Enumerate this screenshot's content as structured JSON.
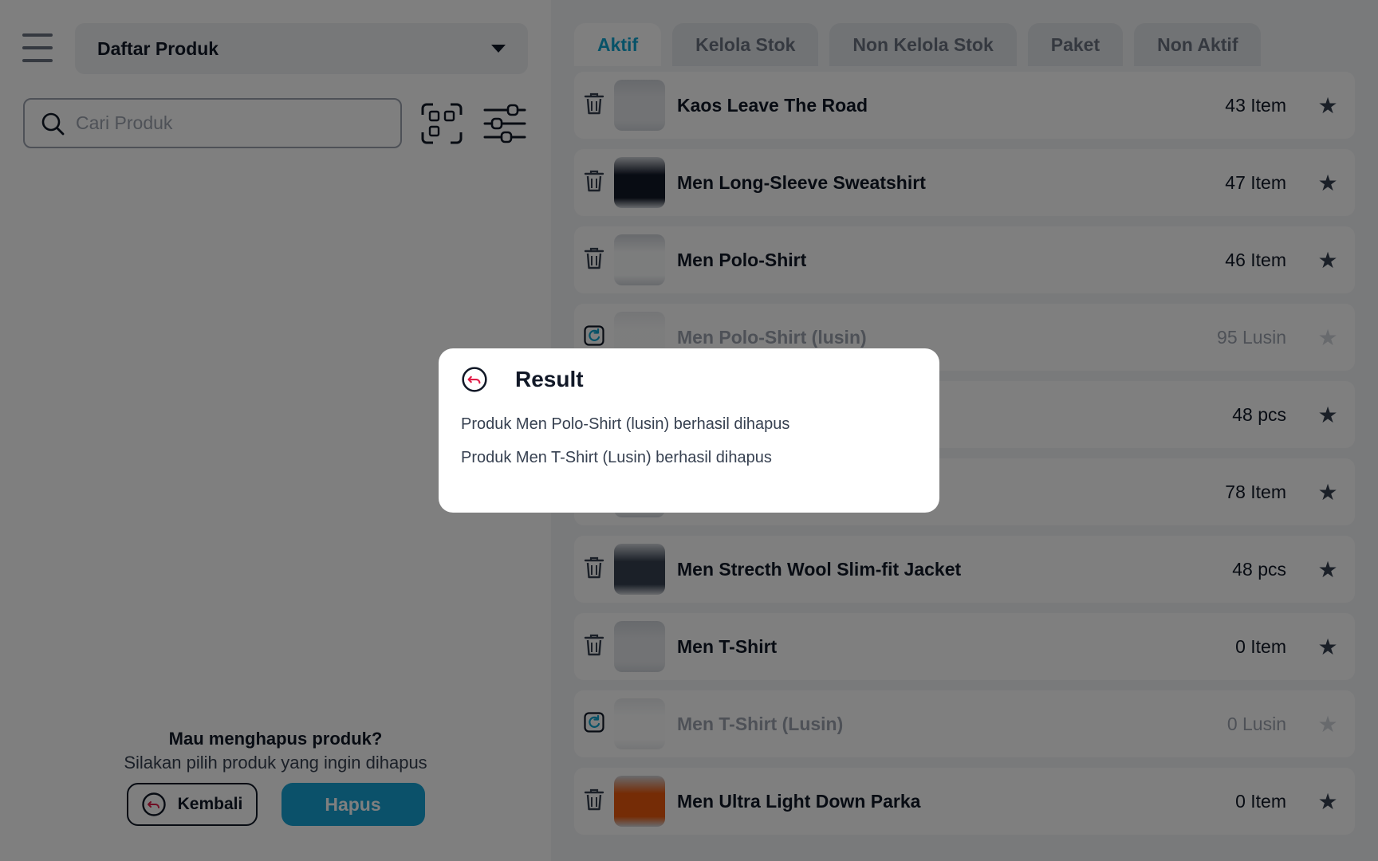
{
  "header": {
    "dropdown_label": "Daftar Produk",
    "search_placeholder": "Cari Produk"
  },
  "tabs": [
    {
      "label": "Aktif",
      "active": true
    },
    {
      "label": "Kelola Stok",
      "active": false
    },
    {
      "label": "Non Kelola Stok",
      "active": false
    },
    {
      "label": "Paket",
      "active": false
    },
    {
      "label": "Non Aktif",
      "active": false
    }
  ],
  "products": [
    {
      "name": "Kaos Leave The Road",
      "qty": "43 Item",
      "state": "active",
      "thumb_color": "#e5e7eb"
    },
    {
      "name": "Men Long-Sleeve Sweatshirt",
      "qty": "47 Item",
      "state": "active",
      "thumb_color": "#111827"
    },
    {
      "name": "Men Polo-Shirt",
      "qty": "46 Item",
      "state": "active",
      "thumb_color": "#f9fafb"
    },
    {
      "name": "Men Polo-Shirt (lusin)",
      "qty": "95 Lusin",
      "state": "inactive",
      "thumb_color": "#f3f4f6"
    },
    {
      "name": "",
      "qty": "48 pcs",
      "state": "active",
      "thumb_color": "#ffffff"
    },
    {
      "name": "",
      "qty": "78 Item",
      "state": "active",
      "thumb_color": "#ffffff"
    },
    {
      "name": "Men Strecth Wool Slim-fit Jacket",
      "qty": "48 pcs",
      "state": "active",
      "thumb_color": "#374151"
    },
    {
      "name": "Men T-Shirt",
      "qty": "0 Item",
      "state": "active",
      "thumb_color": "#e5e7eb"
    },
    {
      "name": "Men T-Shirt (Lusin)",
      "qty": "0 Lusin",
      "state": "inactive",
      "thumb_color": "#f9fafb"
    },
    {
      "name": "Men Ultra Light Down Parka",
      "qty": "0 Item",
      "state": "active",
      "thumb_color": "#ea580c"
    }
  ],
  "bottom": {
    "question": "Mau menghapus produk?",
    "subtitle": "Silakan pilih produk yang ingin dihapus",
    "back_label": "Kembali",
    "delete_label": "Hapus"
  },
  "dialog": {
    "title": "Result",
    "messages": [
      "Produk Men Polo-Shirt (lusin) berhasil dihapus",
      "Produk Men T-Shirt (Lusin) berhasil dihapus"
    ]
  },
  "colors": {
    "accent": "#17a3d4",
    "overlay": "rgba(0,0,0,0.5)",
    "restore_icon": "#0ea5d0",
    "back_arrow": "#e11d48"
  }
}
